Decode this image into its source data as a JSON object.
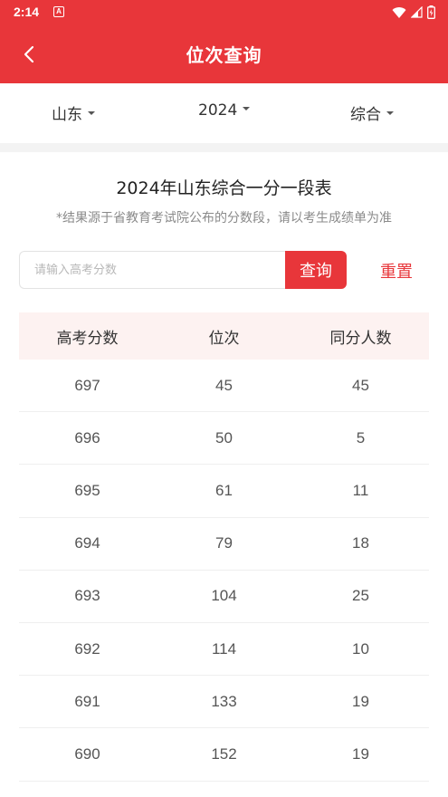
{
  "status_bar": {
    "time": "2:14",
    "notification_icon": "A"
  },
  "app_bar": {
    "title": "位次查询",
    "back_icon": "chevron-left-icon"
  },
  "filters": {
    "province": "山东",
    "year": "2024",
    "subject": "综合"
  },
  "heading": "2024年山东综合一分一段表",
  "note": "*结果源于省教育考试院公布的分数段，请以考生成绩单为准",
  "search": {
    "placeholder": "请输入高考分数",
    "value": "",
    "submit_label": "查询",
    "reset_label": "重置"
  },
  "table": {
    "headers": [
      "高考分数",
      "位次",
      "同分人数"
    ],
    "rows": [
      [
        "697",
        "45",
        "45"
      ],
      [
        "696",
        "50",
        "5"
      ],
      [
        "695",
        "61",
        "11"
      ],
      [
        "694",
        "79",
        "18"
      ],
      [
        "693",
        "104",
        "25"
      ],
      [
        "692",
        "114",
        "10"
      ],
      [
        "691",
        "133",
        "19"
      ],
      [
        "690",
        "152",
        "19"
      ]
    ]
  },
  "colors": {
    "primary": "#e8363a",
    "header_bg": "#fdf2f1",
    "muted_text": "#8a8a8a"
  }
}
